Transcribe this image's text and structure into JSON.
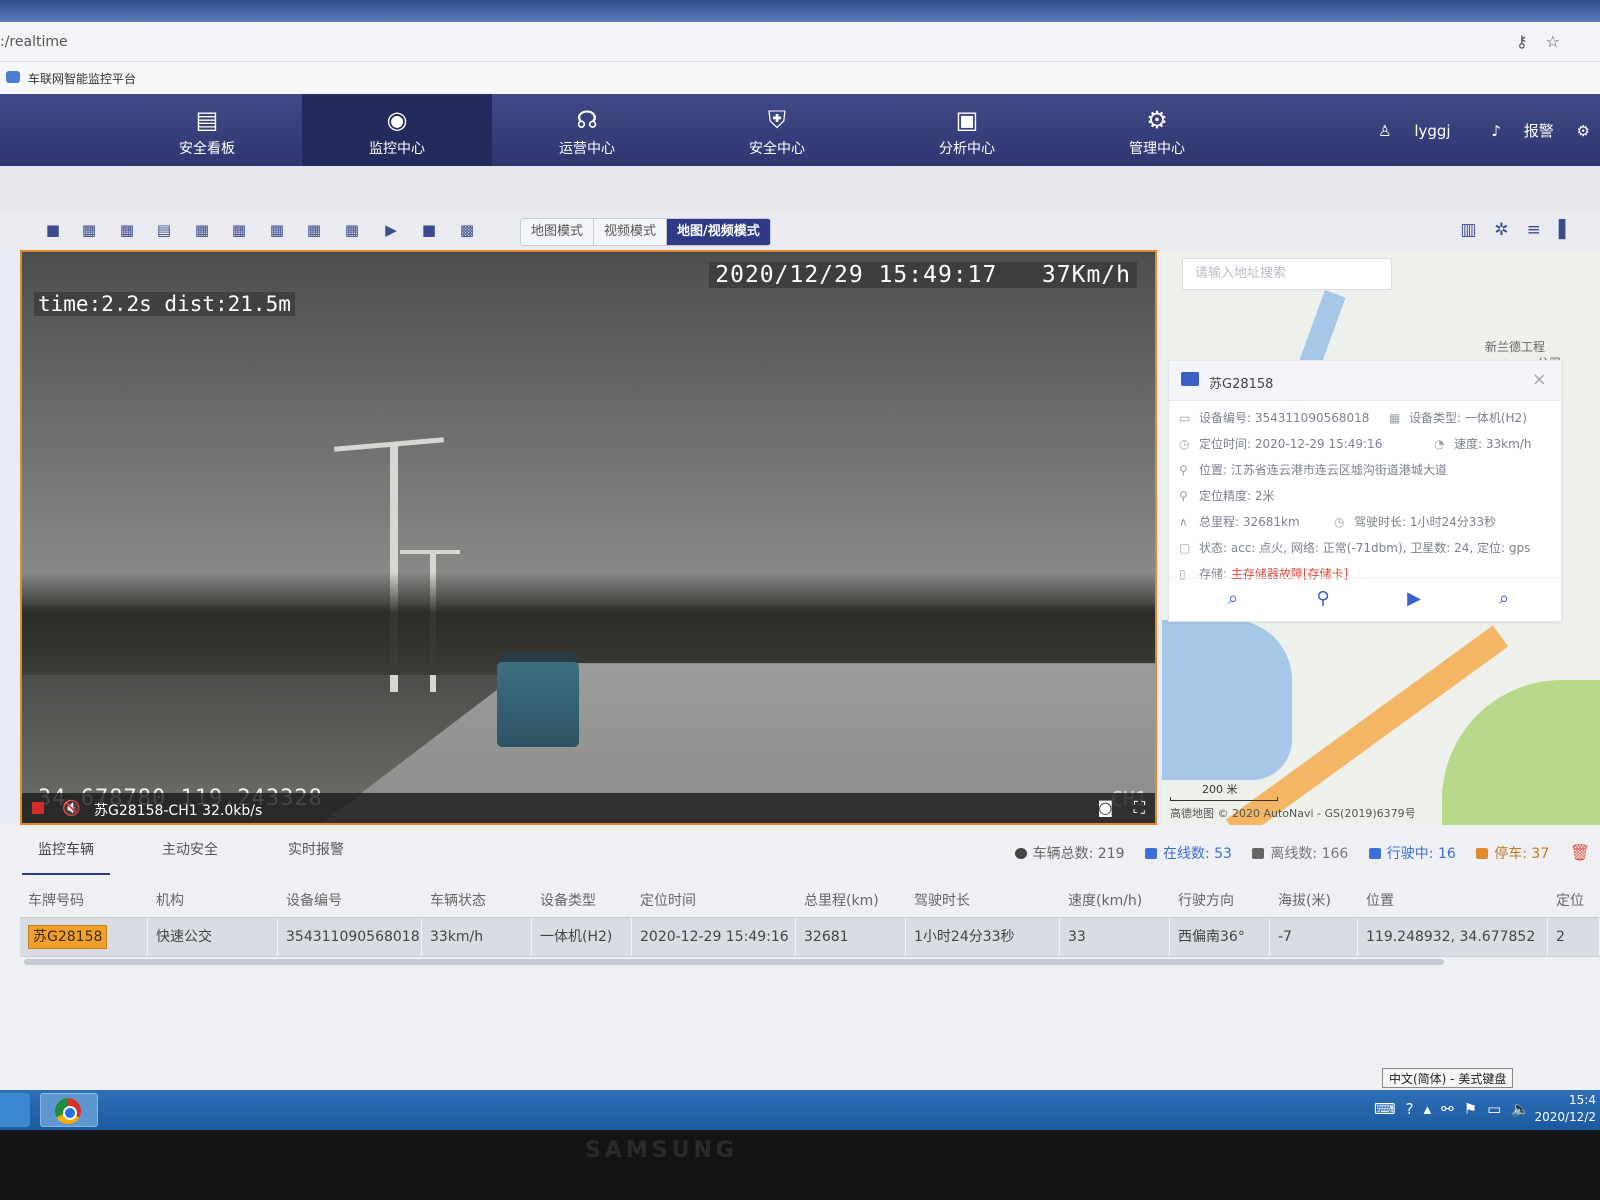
{
  "browser": {
    "url": ":/realtime",
    "tab_title": "车联网智能监控平台"
  },
  "nav": {
    "items": [
      {
        "label": "安全看板",
        "icon": "dashboard-icon"
      },
      {
        "label": "监控中心",
        "icon": "monitor-icon"
      },
      {
        "label": "运营中心",
        "icon": "operator-icon"
      },
      {
        "label": "安全中心",
        "icon": "shield-icon"
      },
      {
        "label": "分析中心",
        "icon": "chart-icon"
      },
      {
        "label": "管理中心",
        "icon": "gear-icon"
      }
    ],
    "active_index": 1,
    "user": "lyggj",
    "alarm_label": "报警"
  },
  "toolbar": {
    "modes": [
      "地图模式",
      "视频模式",
      "地图/视频模式"
    ],
    "active_mode": 2
  },
  "video": {
    "timestamp": "2020/12/29  15:49:17",
    "speed": "37Km/h",
    "overlay_metrics": "time:2.2s  dist:21.5m",
    "coords": "34.678780 119.243328",
    "channel_tag": "CH1",
    "stream_label": "苏G28158-CH1 32.0kb/s"
  },
  "map": {
    "search_placeholder": "请输入地址搜索",
    "place_labels": [
      "新兰德工程",
      "公司"
    ],
    "scale": "200 米",
    "copyright": "高德地图 © 2020 AutoNavi - GS(2019)6379号"
  },
  "vehicle_card": {
    "plate": "苏G28158",
    "rows": [
      {
        "label": "设备编号:",
        "value": "354311090568018"
      },
      {
        "label": "设备类型:",
        "value": "一体机(H2)"
      },
      {
        "label": "定位时间:",
        "value": "2020-12-29 15:49:16"
      },
      {
        "label": "速度:",
        "value": "33km/h"
      },
      {
        "label": "位置:",
        "value": "江苏省连云港市连云区墟沟街道港城大道"
      },
      {
        "label": "定位精度:",
        "value": "2米"
      },
      {
        "label": "总里程:",
        "value": "32681km"
      },
      {
        "label": "驾驶时长:",
        "value": "1小时24分33秒"
      },
      {
        "label": "状态:",
        "value": "acc: 点火, 网络: 正常(-71dbm), 卫星数: 24, 定位: gps"
      },
      {
        "label": "存储:",
        "value": "主存储器故障[存储卡]"
      }
    ]
  },
  "bottom_tabs": [
    "监控车辆",
    "主动安全",
    "实时报警"
  ],
  "stats": [
    {
      "label": "车辆总数:",
      "value": "219",
      "color": "#444444"
    },
    {
      "label": "在线数:",
      "value": "53",
      "color": "#3b6fd6"
    },
    {
      "label": "离线数:",
      "value": "166",
      "color": "#666666"
    },
    {
      "label": "行驶中:",
      "value": "16",
      "color": "#3b6fd6"
    },
    {
      "label": "停车:",
      "value": "37",
      "color": "#e08a2c"
    }
  ],
  "table": {
    "columns": [
      "车牌号码",
      "机构",
      "设备编号",
      "车辆状态",
      "设备类型",
      "定位时间",
      "总里程(km)",
      "驾驶时长",
      "速度(km/h)",
      "行驶方向",
      "海拔(米)",
      "位置",
      "定位"
    ],
    "rows": [
      [
        "苏G28158",
        "快速公交",
        "354311090568018",
        "33km/h",
        "一体机(H2)",
        "2020-12-29 15:49:16",
        "32681",
        "1小时24分33秒",
        "33",
        "西偏南36°",
        "-7",
        "119.248932, 34.677852",
        "2"
      ]
    ]
  },
  "taskbar": {
    "ime": "中文(简体) - 美式键盘",
    "time": "15:4",
    "date": "2020/12/2"
  },
  "monitor_brand": "SAMSUNG"
}
